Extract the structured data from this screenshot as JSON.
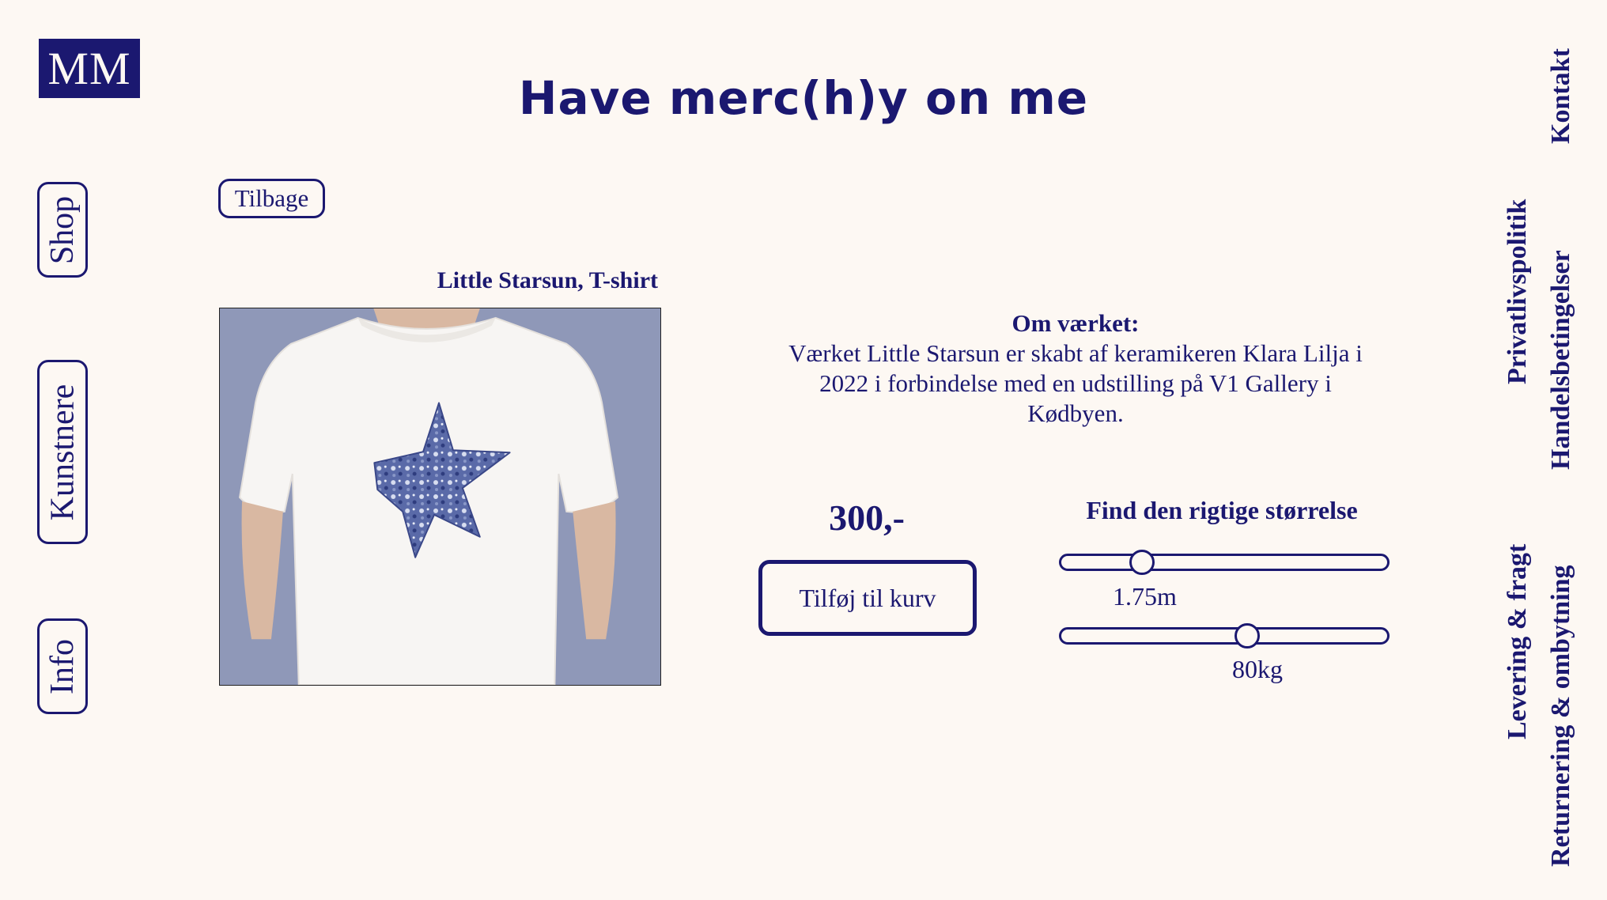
{
  "logo": "MM",
  "site_title": "Have merc(h)y on me",
  "nav": {
    "shop": "Shop",
    "kunstnere": "Kunstnere",
    "info": "Info"
  },
  "back_label": "Tilbage",
  "product": {
    "name": "Little Starsun, T-shirt",
    "about_heading": "Om værket:",
    "about_text": "Værket Little Starsun er skabt af keramikeren Klara Lilja i 2022 i forbindelse med en udstilling på V1 Gallery i Kødbyen.",
    "price": "300,-",
    "add_to_cart": "Tilføj til kurv"
  },
  "size_finder": {
    "title": "Find den rigtige størrelse",
    "height_value": "1.75m",
    "weight_value": "80kg"
  },
  "footer_links": {
    "kontakt": "Kontakt",
    "privatlivspolitik": "Privatlivspolitik",
    "handelsbetingelser": "Handelsbetingelser",
    "levering": "Levering & fragt",
    "returnering": "Returnering & ombytning"
  },
  "colors": {
    "background": "#fdf8f3",
    "accent": "#1b1870",
    "image_background": "#8f98b8"
  }
}
